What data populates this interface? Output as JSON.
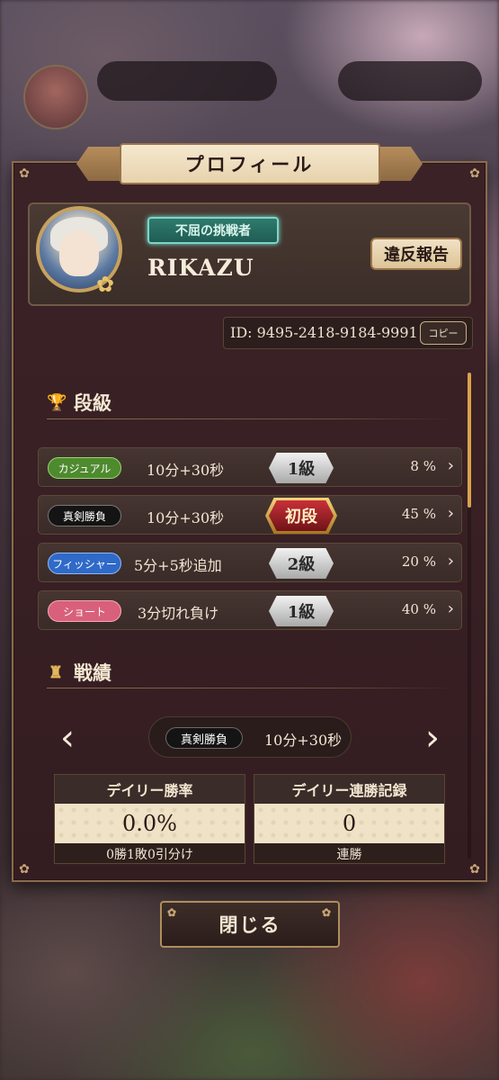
{
  "dialog": {
    "title": "プロフィール",
    "close_label": "閉じる"
  },
  "profile": {
    "badge": "不屈の挑戦者",
    "username": "RIKAZU",
    "report_label": "違反報告",
    "id_text": "ID: 9495-2418-9184-9991",
    "copy_label": "コピー"
  },
  "ranks": {
    "heading": "段級",
    "rows": [
      {
        "mode": "カジュアル",
        "mode_color": "#4e8a2e",
        "time": "10分+30秒",
        "rank": "1級",
        "percent": "8 %"
      },
      {
        "mode": "真剣勝負",
        "mode_color": "#141414",
        "time": "10分+30秒",
        "rank": "初段",
        "percent": "45 %"
      },
      {
        "mode": "フィッシャー",
        "mode_color": "#2f6ac8",
        "time": "5分+5秒追加",
        "rank": "2級",
        "percent": "20 %"
      },
      {
        "mode": "ショート",
        "mode_color": "#d9607a",
        "time": "3分切れ負け",
        "rank": "1級",
        "percent": "40 %"
      }
    ]
  },
  "records": {
    "heading": "戦績",
    "selected_mode": "真剣勝負",
    "selected_time": "10分+30秒",
    "stats": [
      {
        "title": "デイリー勝率",
        "value": "0.0%",
        "detail": "0勝1敗0引分け"
      },
      {
        "title": "デイリー連勝記録",
        "value": "0",
        "detail": "連勝"
      }
    ]
  },
  "icons": {
    "ranks_icon": "trophy-icon",
    "records_icon": "shogi-piece-icon",
    "nav_prev": "chevron-left-icon",
    "nav_next": "chevron-right-icon"
  },
  "colors": {
    "panel": "#3b2226",
    "gold_accent": "#c8a676",
    "scroll_thumb": "#d9a24a"
  }
}
